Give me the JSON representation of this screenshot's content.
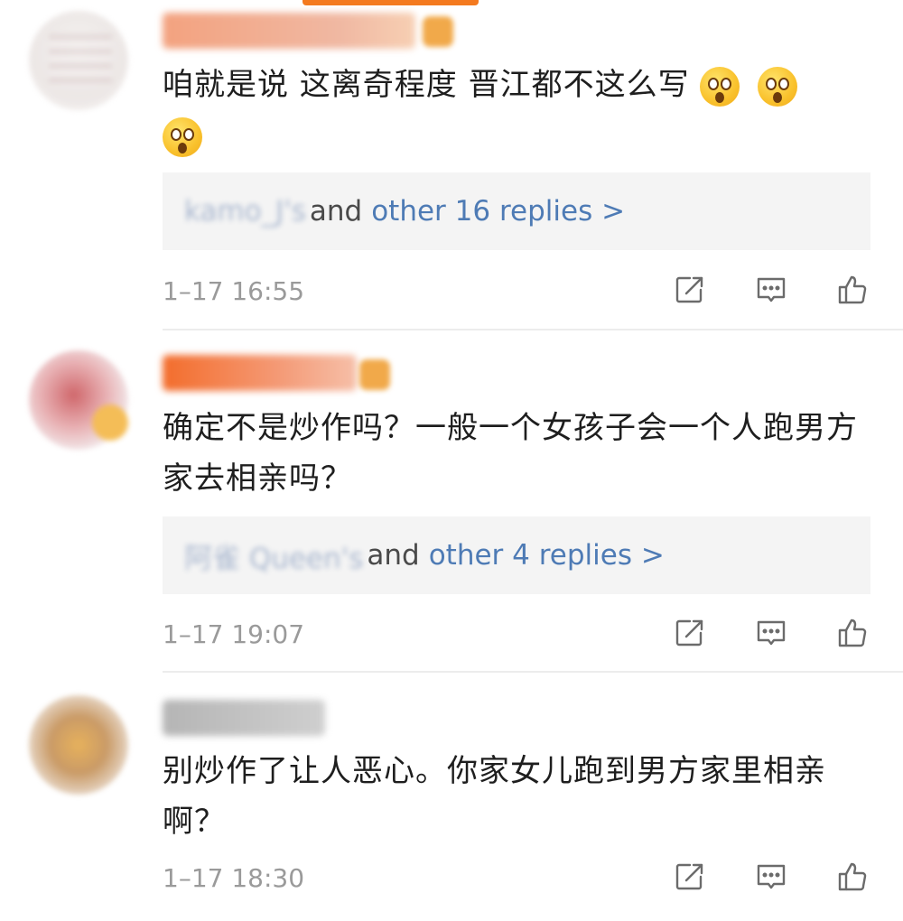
{
  "comments": [
    {
      "text": "咱就是说 这离奇程度 晋江都不这么写",
      "reply_names": "kamo_J's",
      "reply_and": "and",
      "reply_link": "other 16 replies >",
      "time": "1–17 16:55"
    },
    {
      "text": "确定不是炒作吗？一般一个女孩子会一个人跑男方家去相亲吗？",
      "reply_names": "阿雀 Queen's",
      "reply_and": "and",
      "reply_link": "other 4 replies >",
      "time": "1–17 19:07"
    },
    {
      "text": "别炒作了让人恶心。你家女儿跑到男方家里相亲啊？",
      "time": "1–17 18:30"
    }
  ],
  "icons": {
    "share": "share-icon",
    "comment": "comment-icon",
    "like": "thumbs-up-icon",
    "emoji": "shocked-face-emoji"
  },
  "colors": {
    "link": "#4e7bb5",
    "accent": "#f47a1f",
    "timestamp": "#9a9a9a"
  }
}
